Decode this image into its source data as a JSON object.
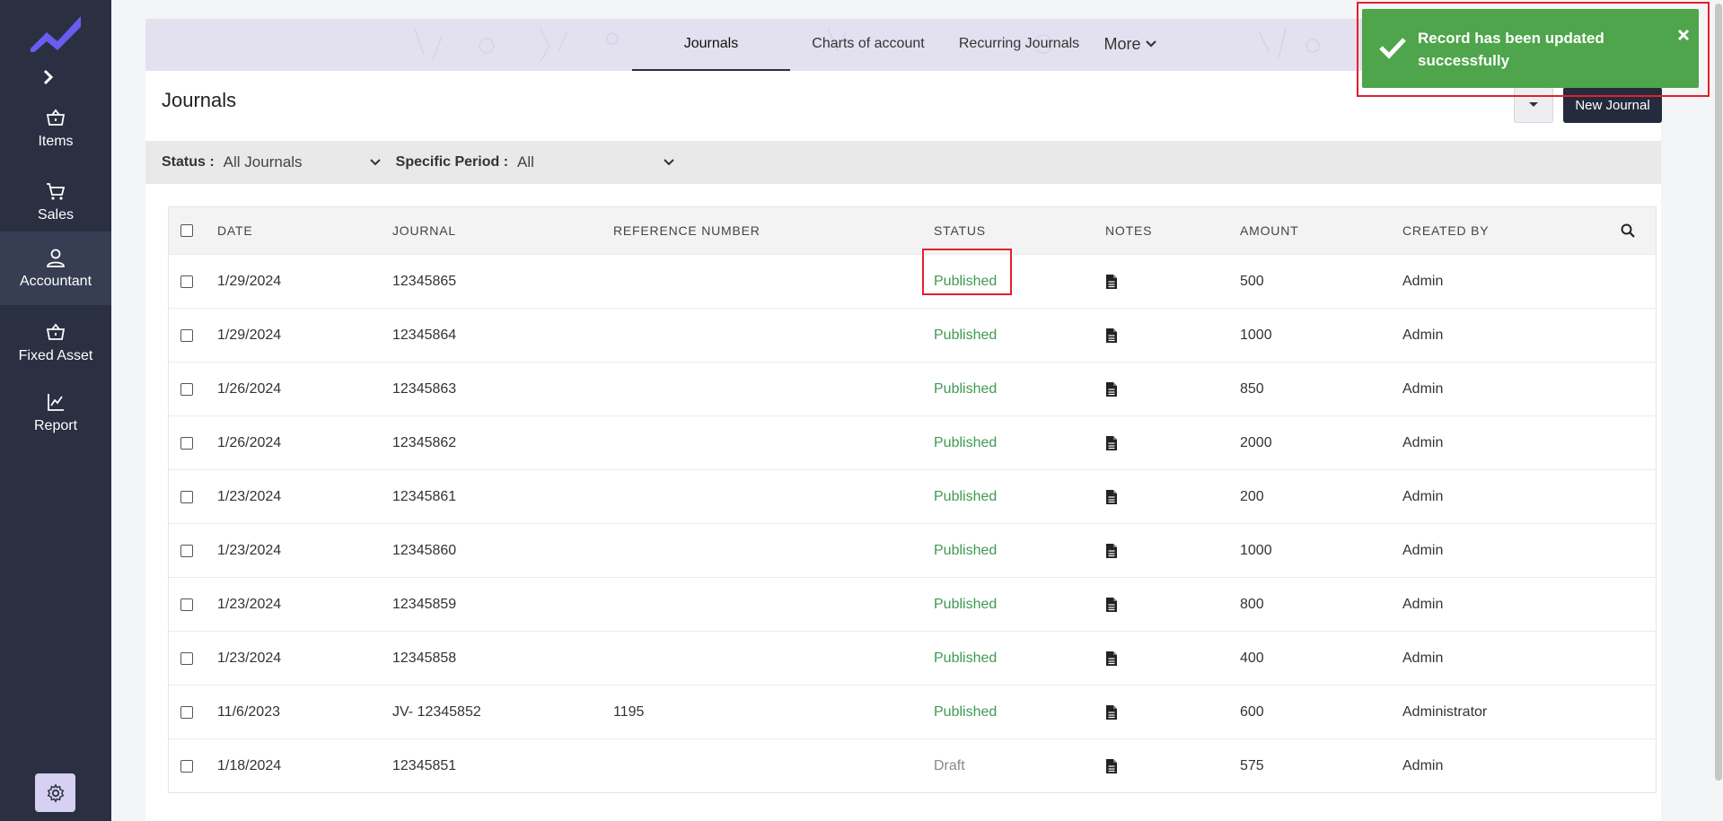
{
  "sidebar": {
    "items": [
      {
        "label": "Items",
        "icon": "basket-icon"
      },
      {
        "label": "Sales",
        "icon": "cart-icon"
      },
      {
        "label": "Accountant",
        "icon": "user-icon",
        "active": true
      },
      {
        "label": "Fixed Asset",
        "icon": "basket-icon"
      },
      {
        "label": "Report",
        "icon": "chart-icon"
      }
    ],
    "settings_icon": "gear-icon"
  },
  "tabs": [
    {
      "label": "Journals",
      "active": true
    },
    {
      "label": "Charts of account"
    },
    {
      "label": "Recurring Journals"
    },
    {
      "label": "More"
    }
  ],
  "page": {
    "title": "Journals",
    "new_button": "New Journal"
  },
  "filters": {
    "status_label": "Status :",
    "status_value": "All Journals",
    "period_label": "Specific Period :",
    "period_value": "All"
  },
  "table": {
    "columns": [
      "DATE",
      "JOURNAL",
      "REFERENCE NUMBER",
      "STATUS",
      "NOTES",
      "AMOUNT",
      "CREATED BY"
    ],
    "rows": [
      {
        "date": "1/29/2024",
        "journal": "12345865",
        "ref": "",
        "status": "Published",
        "amount": "500",
        "created_by": "Admin"
      },
      {
        "date": "1/29/2024",
        "journal": "12345864",
        "ref": "",
        "status": "Published",
        "amount": "1000",
        "created_by": "Admin"
      },
      {
        "date": "1/26/2024",
        "journal": "12345863",
        "ref": "",
        "status": "Published",
        "amount": "850",
        "created_by": "Admin"
      },
      {
        "date": "1/26/2024",
        "journal": "12345862",
        "ref": "",
        "status": "Published",
        "amount": "2000",
        "created_by": "Admin"
      },
      {
        "date": "1/23/2024",
        "journal": "12345861",
        "ref": "",
        "status": "Published",
        "amount": "200",
        "created_by": "Admin"
      },
      {
        "date": "1/23/2024",
        "journal": "12345860",
        "ref": "",
        "status": "Published",
        "amount": "1000",
        "created_by": "Admin"
      },
      {
        "date": "1/23/2024",
        "journal": "12345859",
        "ref": "",
        "status": "Published",
        "amount": "800",
        "created_by": "Admin"
      },
      {
        "date": "1/23/2024",
        "journal": "12345858",
        "ref": "",
        "status": "Published",
        "amount": "400",
        "created_by": "Admin"
      },
      {
        "date": "11/6/2023",
        "journal": "JV- 12345852",
        "ref": "1195",
        "status": "Published",
        "amount": "600",
        "created_by": "Administrator"
      },
      {
        "date": "1/18/2024",
        "journal": "12345851",
        "ref": "",
        "status": "Draft",
        "amount": "575",
        "created_by": "Admin"
      }
    ]
  },
  "toast": {
    "message": "Record has been updated successfully",
    "color": "#4ea54b"
  },
  "colors": {
    "sidebar": "#2a2f42",
    "published": "#3f9a52",
    "draft": "#888888",
    "highlight": "#e3202a"
  }
}
